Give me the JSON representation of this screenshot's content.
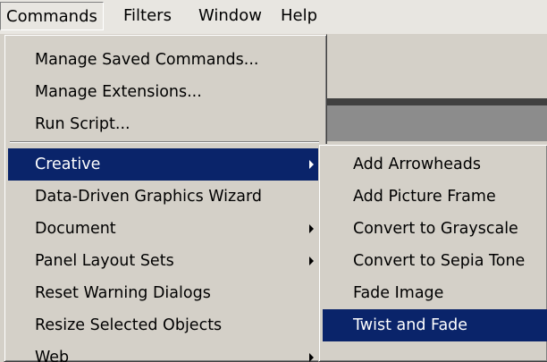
{
  "menubar": {
    "items": [
      {
        "label": "Commands"
      },
      {
        "label": "Filters"
      },
      {
        "label": "Window"
      },
      {
        "label": "Help"
      }
    ]
  },
  "commands_menu": {
    "group1": [
      {
        "label": "Manage Saved Commands..."
      },
      {
        "label": "Manage Extensions..."
      },
      {
        "label": "Run Script..."
      }
    ],
    "group2": [
      {
        "label": "Creative",
        "submenu": true
      },
      {
        "label": "Data-Driven Graphics Wizard",
        "submenu": false
      },
      {
        "label": "Document",
        "submenu": true
      },
      {
        "label": "Panel Layout Sets",
        "submenu": true
      },
      {
        "label": "Reset Warning Dialogs",
        "submenu": false
      },
      {
        "label": "Resize Selected Objects",
        "submenu": false
      },
      {
        "label": "Web",
        "submenu": true
      }
    ],
    "selected": "Creative"
  },
  "creative_submenu": {
    "items": [
      {
        "label": "Add Arrowheads"
      },
      {
        "label": "Add Picture Frame"
      },
      {
        "label": "Convert to Grayscale"
      },
      {
        "label": "Convert to Sepia Tone"
      },
      {
        "label": "Fade Image"
      },
      {
        "label": "Twist and Fade"
      }
    ],
    "selected": "Twist and Fade"
  },
  "colors": {
    "menu_face": "#d4d0c8",
    "highlight": "#0a246a",
    "highlight_text": "#ffffff"
  }
}
